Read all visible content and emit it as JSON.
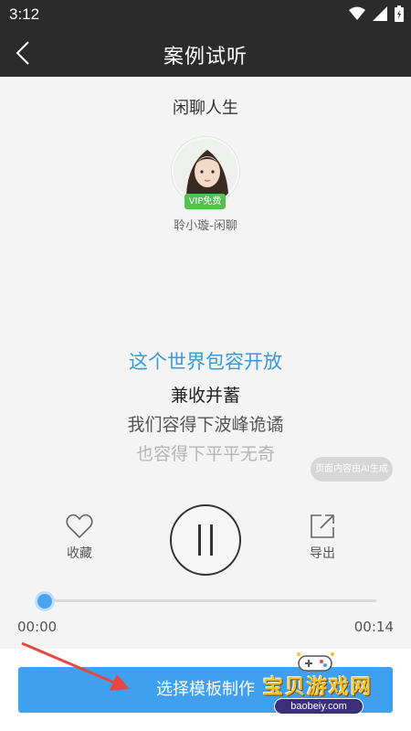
{
  "status_bar": {
    "time": "3:12"
  },
  "app_bar": {
    "title": "案例试听"
  },
  "work": {
    "title": "闲聊人生"
  },
  "speaker": {
    "vip_badge": "VIP免费",
    "name": "聆小璇-闲聊"
  },
  "lyrics": [
    "这个世界包容开放",
    "兼收并蓄",
    "我们容得下波峰诡谲",
    "也容得下平平无奇"
  ],
  "ai_notice": "页面内容由AI生成",
  "controls": {
    "favorite_label": "收藏",
    "export_label": "导出"
  },
  "progress": {
    "current": "00:00",
    "total": "00:14",
    "fraction": 0.0
  },
  "action_button": {
    "label": "选择模板制作"
  },
  "watermark": {
    "title": "宝贝游戏网",
    "url": "baobeiy.com"
  },
  "colors": {
    "accent": "#3fa0ef",
    "lyric_active": "#3a9ad9",
    "vip": "#55c152",
    "bar": "#2b2b2b"
  }
}
